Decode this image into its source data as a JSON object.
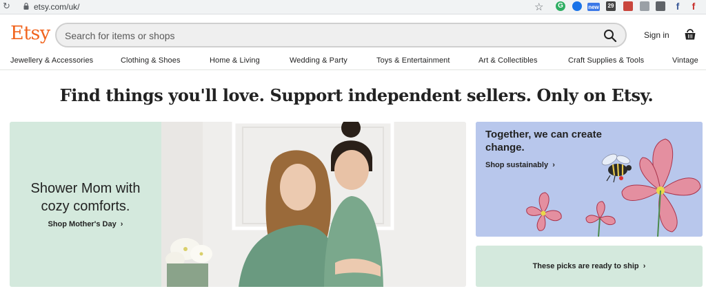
{
  "browser": {
    "url": "etsy.com/uk/",
    "extensions": {
      "new_badge": "new",
      "count_badge": "29"
    }
  },
  "header": {
    "logo": "Etsy",
    "search_placeholder": "Search for items or shops",
    "sign_in": "Sign in"
  },
  "categories": [
    "Jewellery & Accessories",
    "Clothing & Shoes",
    "Home & Living",
    "Wedding & Party",
    "Toys & Entertainment",
    "Art & Collectibles",
    "Craft Supplies & Tools",
    "Vintage"
  ],
  "headline": "Find things you'll love. Support independent sellers. Only on Etsy.",
  "hero": {
    "title": "Shower Mom with cozy comforts.",
    "link": "Shop Mother's Day"
  },
  "sustain_card": {
    "title": "Together, we can create change.",
    "link": "Shop sustainably"
  },
  "ship_card": {
    "link": "These picks are ready to ship"
  },
  "colors": {
    "brand": "#f1641e",
    "mint": "#d4e9dd",
    "periwinkle": "#b8c7ec"
  }
}
